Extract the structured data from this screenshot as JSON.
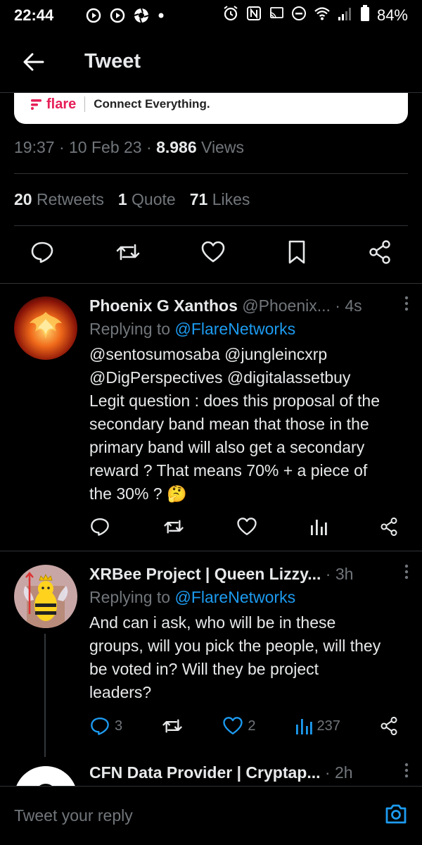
{
  "status_bar": {
    "time": "22:44",
    "battery": "84%",
    "icons": [
      "play-icon",
      "play-icon",
      "aperture-icon",
      "dot-icon",
      "alarm-icon",
      "nfc-icon",
      "cast-icon",
      "dnd-icon",
      "wifi-icon",
      "signal-icon",
      "battery-icon"
    ]
  },
  "header": {
    "title": "Tweet"
  },
  "link_card": {
    "brand": "flare",
    "tagline": "Connect Everything."
  },
  "tweet_meta": {
    "time": "19:37",
    "dot1": "·",
    "date": "10 Feb 23",
    "dot2": "·",
    "views_count": "8.986",
    "views_label": "Views"
  },
  "tweet_stats": {
    "retweets_count": "20",
    "retweets_label": "Retweets",
    "quotes_count": "1",
    "quotes_label": "Quote",
    "likes_count": "71",
    "likes_label": "Likes"
  },
  "replies": [
    {
      "name": "Phoenix G Xanthos",
      "handle": "@Phoenix...",
      "time": "· 4s",
      "replying_prefix": "Replying to",
      "replying_to": "@FlareNetworks",
      "mentions_line1": "@sentosumosaba @jungleincxrp",
      "mentions_line2": "@DigPerspectives @digitalassetbuy",
      "text_lines": [
        "Legit question : does this proposal of the",
        "secondary band mean that those in the",
        "primary band will also get a secondary",
        "reward ? That means 70% + a piece of",
        "the 30% ?"
      ],
      "emoji": "🤔"
    },
    {
      "name": "XRBee Project | Queen Lizzy...",
      "time": "· 3h",
      "replying_prefix": "Replying to",
      "replying_to": "@FlareNetworks",
      "text_lines": [
        "And can i ask, who will be in these",
        "groups, will you pick the people, will they",
        "be voted in? Will they be project",
        "leaders?"
      ],
      "reply_count": "3",
      "like_count": "2",
      "view_count": "237"
    },
    {
      "name": "CFN Data Provider | Cryptap...",
      "time": "· 2h"
    }
  ],
  "composer": {
    "placeholder": "Tweet your reply"
  },
  "colors": {
    "background": "#000000",
    "text": "#e7e9ea",
    "muted": "#71767b",
    "link": "#1d9bf0",
    "divider": "#2f3336",
    "brand": "#e62058"
  }
}
